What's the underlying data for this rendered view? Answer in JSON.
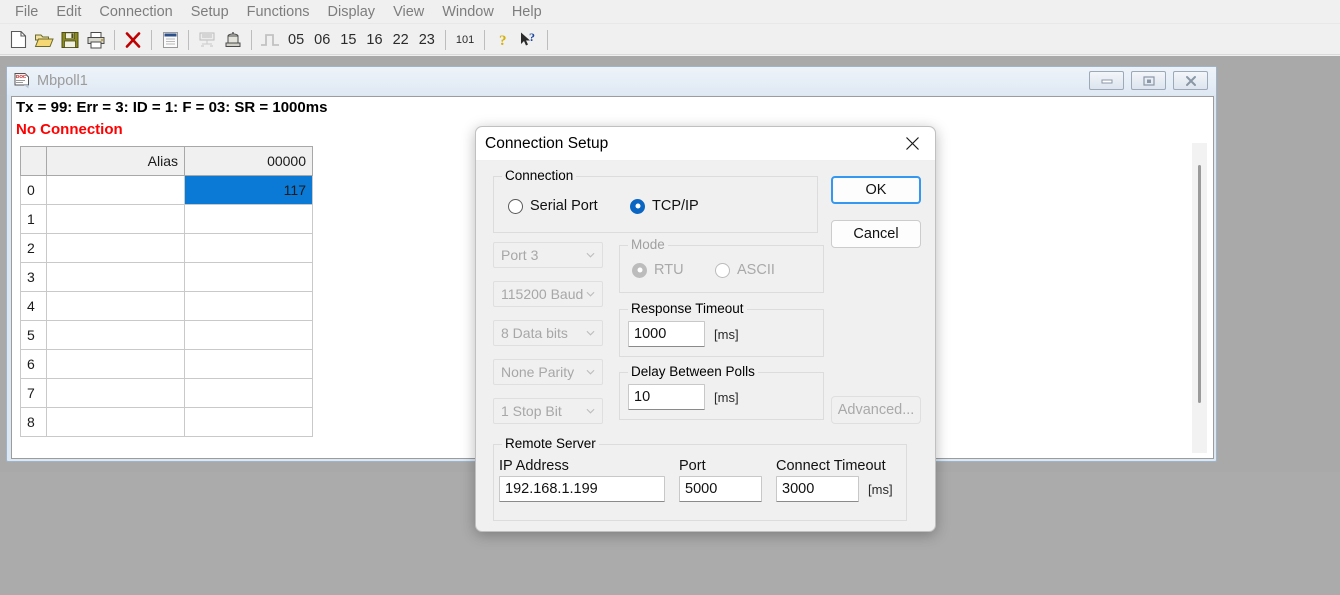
{
  "menubar": {
    "items": [
      {
        "label": "File"
      },
      {
        "label": "Edit"
      },
      {
        "label": "Connection"
      },
      {
        "label": "Setup"
      },
      {
        "label": "Functions"
      },
      {
        "label": "Display"
      },
      {
        "label": "View"
      },
      {
        "label": "Window"
      },
      {
        "label": "Help"
      }
    ]
  },
  "toolbar": {
    "function_codes": [
      "05",
      "06",
      "15",
      "16",
      "22",
      "23"
    ],
    "raw_data_label": "101"
  },
  "mdi_child": {
    "title": "Mbpoll1",
    "status_line": "Tx = 99: Err = 3: ID = 1: F = 03: SR = 1000ms",
    "connection_status": "No Connection",
    "connection_status_color": "#ff0000"
  },
  "grid": {
    "headers": [
      "",
      "Alias",
      "00000"
    ],
    "rows": [
      {
        "index": "0",
        "alias": "",
        "value": "117",
        "selected": true
      },
      {
        "index": "1",
        "alias": "",
        "value": "",
        "selected": false
      },
      {
        "index": "2",
        "alias": "",
        "value": "",
        "selected": false
      },
      {
        "index": "3",
        "alias": "",
        "value": "",
        "selected": false
      },
      {
        "index": "4",
        "alias": "",
        "value": "",
        "selected": false
      },
      {
        "index": "5",
        "alias": "",
        "value": "",
        "selected": false
      },
      {
        "index": "6",
        "alias": "",
        "value": "",
        "selected": false
      },
      {
        "index": "7",
        "alias": "",
        "value": "",
        "selected": false
      },
      {
        "index": "8",
        "alias": "",
        "value": "",
        "selected": false
      }
    ],
    "selection_color": "#0a7ad6"
  },
  "dialog": {
    "title": "Connection Setup",
    "connection_group": {
      "label": "Connection",
      "options": [
        {
          "label": "Serial Port",
          "checked": false
        },
        {
          "label": "TCP/IP",
          "checked": true
        }
      ]
    },
    "serial_settings": {
      "port": "Port 3",
      "baud": "115200 Baud",
      "data_bits": "8 Data bits",
      "parity": "None Parity",
      "stop_bits": "1 Stop Bit",
      "enabled": false
    },
    "mode_group": {
      "label": "Mode",
      "options": [
        {
          "label": "RTU",
          "checked": true
        },
        {
          "label": "ASCII",
          "checked": false
        }
      ],
      "enabled": false
    },
    "response_timeout": {
      "label": "Response Timeout",
      "value": "1000",
      "unit": "[ms]"
    },
    "delay_between_polls": {
      "label": "Delay Between Polls",
      "value": "10",
      "unit": "[ms]"
    },
    "remote_server": {
      "label": "Remote Server",
      "ip_label": "IP Address",
      "ip_value": "192.168.1.199",
      "port_label": "Port",
      "port_value": "5000",
      "connect_timeout_label": "Connect Timeout",
      "connect_timeout_value": "3000",
      "connect_timeout_unit": "[ms]"
    },
    "buttons": {
      "ok": "OK",
      "cancel": "Cancel",
      "advanced": "Advanced..."
    }
  }
}
